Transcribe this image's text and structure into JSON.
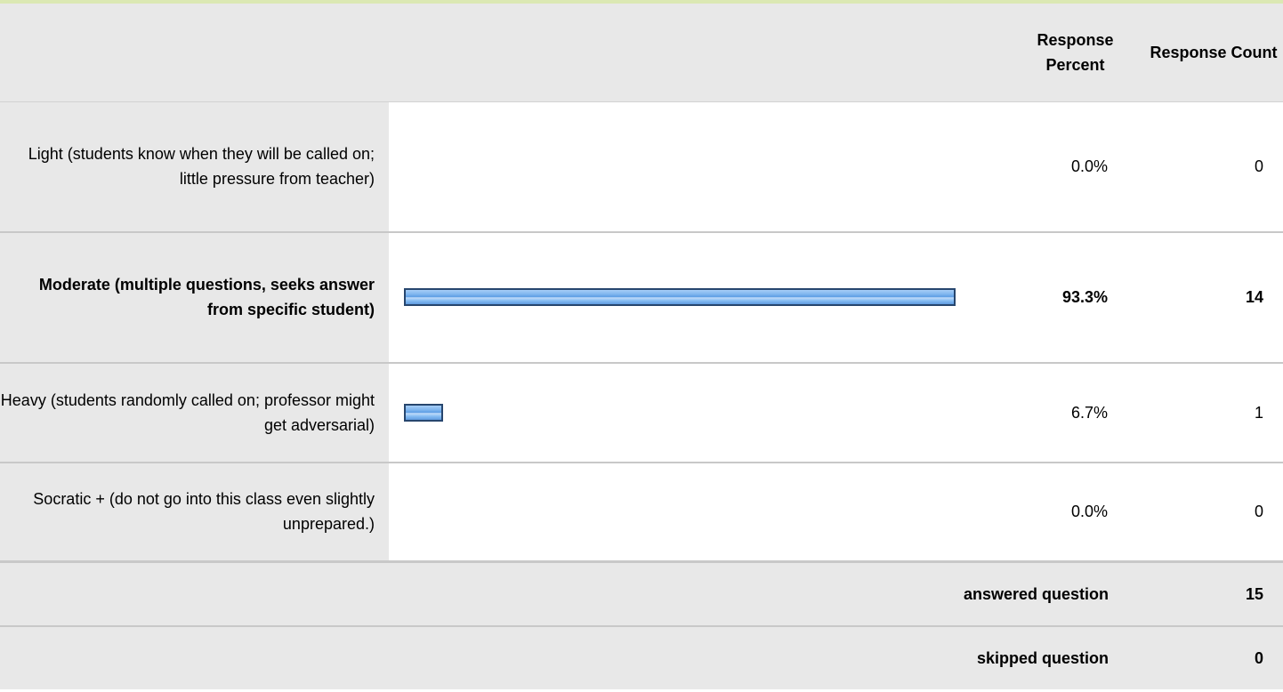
{
  "header": {
    "percent_label": "Response Percent",
    "count_label": "Response Count"
  },
  "answers": [
    {
      "label": "Light (students know when they will be called on; little pressure from teacher)",
      "percent": "0.0%",
      "count": "0",
      "fraction": 0.0,
      "bold": false
    },
    {
      "label": "Moderate (multiple questions, seeks answer from specific student)",
      "percent": "93.3%",
      "count": "14",
      "fraction": 0.933,
      "bold": true
    },
    {
      "label": "Heavy (students randomly called on; professor might get adversarial)",
      "percent": "6.7%",
      "count": "1",
      "fraction": 0.067,
      "bold": false
    },
    {
      "label": "Socratic + (do not go into this class even slightly unprepared.)",
      "percent": "0.0%",
      "count": "0",
      "fraction": 0.0,
      "bold": false
    }
  ],
  "summary": {
    "answered_label": "answered question",
    "answered_count": "15",
    "skipped_label": "skipped question",
    "skipped_count": "0"
  },
  "colors": {
    "bar_border": "#27466e",
    "bar_fill": "#7fb6ef",
    "label_background": "#e8e8e8",
    "top_strip": "#dbe8b3"
  }
}
